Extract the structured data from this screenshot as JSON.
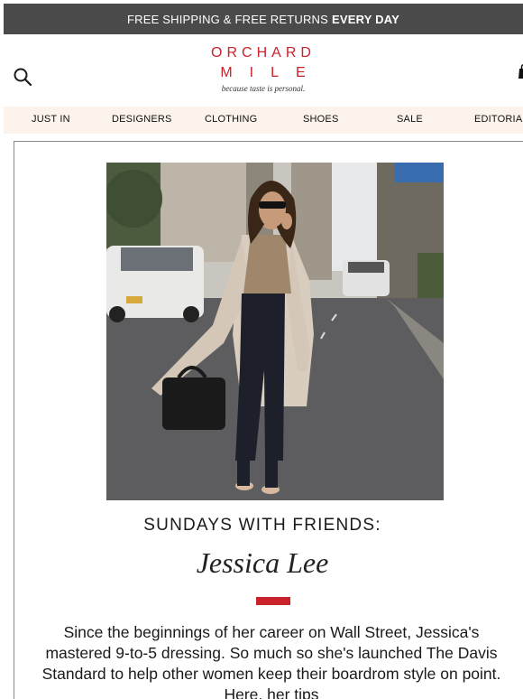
{
  "promo": {
    "text": "FREE SHIPPING & FREE RETURNS",
    "bold": "EVERY DAY"
  },
  "logo": {
    "line1": "ORCHARD",
    "line2": "MILE",
    "tagline": "because taste is personal."
  },
  "icons": {
    "search": "search-icon",
    "bag": "shopping-bag-icon"
  },
  "nav": {
    "items": [
      {
        "label": "JUST IN"
      },
      {
        "label": "DESIGNERS"
      },
      {
        "label": "CLOTHING"
      },
      {
        "label": "SHOES"
      },
      {
        "label": "SALE"
      },
      {
        "label": "EDITORIAL"
      }
    ]
  },
  "article": {
    "kicker": "SUNDAYS WITH FRIENDS:",
    "name": "Jessica Lee",
    "accent_color": "#c8232c",
    "body": "Since the beginnings of her career on Wall Street, Jessica's mastered 9-to-5 dressing. So much so she's launched The Davis Standard to help other women keep their boardrom style on point. Here, her tips"
  },
  "colors": {
    "brand": "#c8232c",
    "promo_bg": "#4a4a4a",
    "nav_bg": "#fbf3ec"
  }
}
